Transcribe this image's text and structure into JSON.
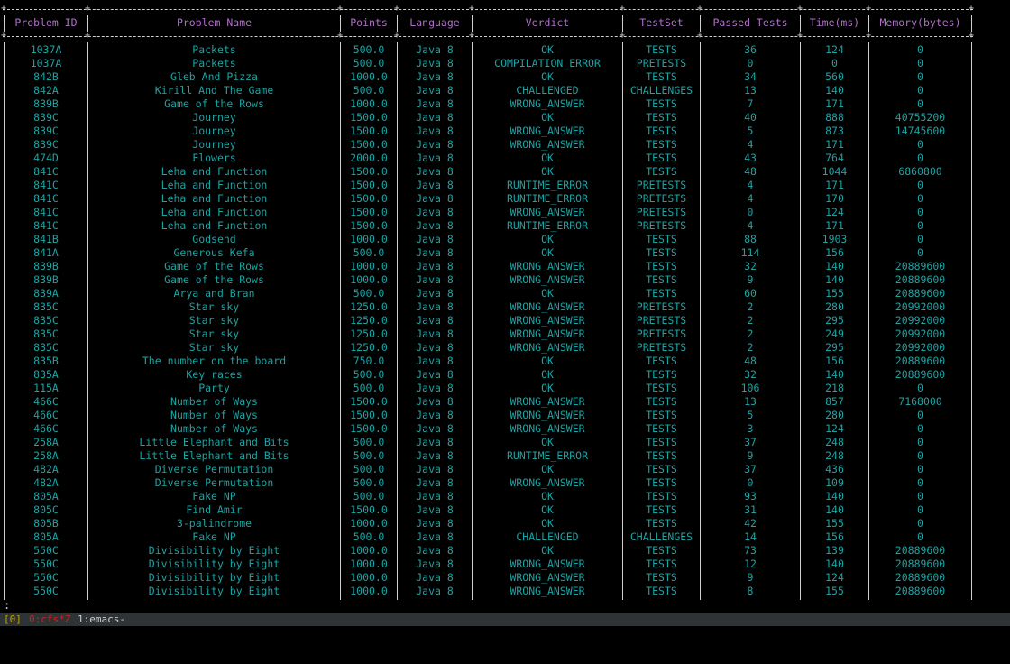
{
  "colors": {
    "background": "#000000",
    "text": "#1ca3a3",
    "header_text": "#b06ec8",
    "border": "#d0d0d0",
    "status_bar_bg": "#2e3436"
  },
  "table": {
    "columns": [
      "Problem ID",
      "Problem Name",
      "Points",
      "Language",
      "Verdict",
      "TestSet",
      "Passed Tests",
      "Time(ms)",
      "Memory(bytes)"
    ],
    "rows": [
      [
        "1037A",
        "Packets",
        "500.0",
        "Java 8",
        "OK",
        "TESTS",
        "36",
        "124",
        "0"
      ],
      [
        "1037A",
        "Packets",
        "500.0",
        "Java 8",
        "COMPILATION_ERROR",
        "PRETESTS",
        "0",
        "0",
        "0"
      ],
      [
        "842B",
        "Gleb And Pizza",
        "1000.0",
        "Java 8",
        "OK",
        "TESTS",
        "34",
        "560",
        "0"
      ],
      [
        "842A",
        "Kirill And The Game",
        "500.0",
        "Java 8",
        "CHALLENGED",
        "CHALLENGES",
        "13",
        "140",
        "0"
      ],
      [
        "839B",
        "Game of the Rows",
        "1000.0",
        "Java 8",
        "WRONG_ANSWER",
        "TESTS",
        "7",
        "171",
        "0"
      ],
      [
        "839C",
        "Journey",
        "1500.0",
        "Java 8",
        "OK",
        "TESTS",
        "40",
        "888",
        "40755200"
      ],
      [
        "839C",
        "Journey",
        "1500.0",
        "Java 8",
        "WRONG_ANSWER",
        "TESTS",
        "5",
        "873",
        "14745600"
      ],
      [
        "839C",
        "Journey",
        "1500.0",
        "Java 8",
        "WRONG_ANSWER",
        "TESTS",
        "4",
        "171",
        "0"
      ],
      [
        "474D",
        "Flowers",
        "2000.0",
        "Java 8",
        "OK",
        "TESTS",
        "43",
        "764",
        "0"
      ],
      [
        "841C",
        "Leha and Function",
        "1500.0",
        "Java 8",
        "OK",
        "TESTS",
        "48",
        "1044",
        "6860800"
      ],
      [
        "841C",
        "Leha and Function",
        "1500.0",
        "Java 8",
        "RUNTIME_ERROR",
        "PRETESTS",
        "4",
        "171",
        "0"
      ],
      [
        "841C",
        "Leha and Function",
        "1500.0",
        "Java 8",
        "RUNTIME_ERROR",
        "PRETESTS",
        "4",
        "170",
        "0"
      ],
      [
        "841C",
        "Leha and Function",
        "1500.0",
        "Java 8",
        "WRONG_ANSWER",
        "PRETESTS",
        "0",
        "124",
        "0"
      ],
      [
        "841C",
        "Leha and Function",
        "1500.0",
        "Java 8",
        "RUNTIME_ERROR",
        "PRETESTS",
        "4",
        "171",
        "0"
      ],
      [
        "841B",
        "Godsend",
        "1000.0",
        "Java 8",
        "OK",
        "TESTS",
        "88",
        "1903",
        "0"
      ],
      [
        "841A",
        "Generous Kefa",
        "500.0",
        "Java 8",
        "OK",
        "TESTS",
        "114",
        "156",
        "0"
      ],
      [
        "839B",
        "Game of the Rows",
        "1000.0",
        "Java 8",
        "WRONG_ANSWER",
        "TESTS",
        "32",
        "140",
        "20889600"
      ],
      [
        "839B",
        "Game of the Rows",
        "1000.0",
        "Java 8",
        "WRONG_ANSWER",
        "TESTS",
        "9",
        "140",
        "20889600"
      ],
      [
        "839A",
        "Arya and Bran",
        "500.0",
        "Java 8",
        "OK",
        "TESTS",
        "60",
        "155",
        "20889600"
      ],
      [
        "835C",
        "Star sky",
        "1250.0",
        "Java 8",
        "WRONG_ANSWER",
        "PRETESTS",
        "2",
        "280",
        "20992000"
      ],
      [
        "835C",
        "Star sky",
        "1250.0",
        "Java 8",
        "WRONG_ANSWER",
        "PRETESTS",
        "2",
        "295",
        "20992000"
      ],
      [
        "835C",
        "Star sky",
        "1250.0",
        "Java 8",
        "WRONG_ANSWER",
        "PRETESTS",
        "2",
        "249",
        "20992000"
      ],
      [
        "835C",
        "Star sky",
        "1250.0",
        "Java 8",
        "WRONG_ANSWER",
        "PRETESTS",
        "2",
        "295",
        "20992000"
      ],
      [
        "835B",
        "The number on the board",
        "750.0",
        "Java 8",
        "OK",
        "TESTS",
        "48",
        "156",
        "20889600"
      ],
      [
        "835A",
        "Key races",
        "500.0",
        "Java 8",
        "OK",
        "TESTS",
        "32",
        "140",
        "20889600"
      ],
      [
        "115A",
        "Party",
        "500.0",
        "Java 8",
        "OK",
        "TESTS",
        "106",
        "218",
        "0"
      ],
      [
        "466C",
        "Number of Ways",
        "1500.0",
        "Java 8",
        "WRONG_ANSWER",
        "TESTS",
        "13",
        "857",
        "7168000"
      ],
      [
        "466C",
        "Number of Ways",
        "1500.0",
        "Java 8",
        "WRONG_ANSWER",
        "TESTS",
        "5",
        "280",
        "0"
      ],
      [
        "466C",
        "Number of Ways",
        "1500.0",
        "Java 8",
        "WRONG_ANSWER",
        "TESTS",
        "3",
        "124",
        "0"
      ],
      [
        "258A",
        "Little Elephant and Bits",
        "500.0",
        "Java 8",
        "OK",
        "TESTS",
        "37",
        "248",
        "0"
      ],
      [
        "258A",
        "Little Elephant and Bits",
        "500.0",
        "Java 8",
        "RUNTIME_ERROR",
        "TESTS",
        "9",
        "248",
        "0"
      ],
      [
        "482A",
        "Diverse Permutation",
        "500.0",
        "Java 8",
        "OK",
        "TESTS",
        "37",
        "436",
        "0"
      ],
      [
        "482A",
        "Diverse Permutation",
        "500.0",
        "Java 8",
        "WRONG_ANSWER",
        "TESTS",
        "0",
        "109",
        "0"
      ],
      [
        "805A",
        "Fake NP",
        "500.0",
        "Java 8",
        "OK",
        "TESTS",
        "93",
        "140",
        "0"
      ],
      [
        "805C",
        "Find Amir",
        "1500.0",
        "Java 8",
        "OK",
        "TESTS",
        "31",
        "140",
        "0"
      ],
      [
        "805B",
        "3-palindrome",
        "1000.0",
        "Java 8",
        "OK",
        "TESTS",
        "42",
        "155",
        "0"
      ],
      [
        "805A",
        "Fake NP",
        "500.0",
        "Java 8",
        "CHALLENGED",
        "CHALLENGES",
        "14",
        "156",
        "0"
      ],
      [
        "550C",
        "Divisibility by Eight",
        "1000.0",
        "Java 8",
        "OK",
        "TESTS",
        "73",
        "139",
        "20889600"
      ],
      [
        "550C",
        "Divisibility by Eight",
        "1000.0",
        "Java 8",
        "WRONG_ANSWER",
        "TESTS",
        "12",
        "140",
        "20889600"
      ],
      [
        "550C",
        "Divisibility by Eight",
        "1000.0",
        "Java 8",
        "WRONG_ANSWER",
        "TESTS",
        "9",
        "124",
        "20889600"
      ],
      [
        "550C",
        "Divisibility by Eight",
        "1000.0",
        "Java 8",
        "WRONG_ANSWER",
        "TESTS",
        "8",
        "155",
        "20889600"
      ]
    ]
  },
  "prompt": {
    "cursor": ":"
  },
  "status_bar": {
    "session": "[0]",
    "window_active": "0:cfs*Z",
    "window_other": "1:emacs-"
  }
}
